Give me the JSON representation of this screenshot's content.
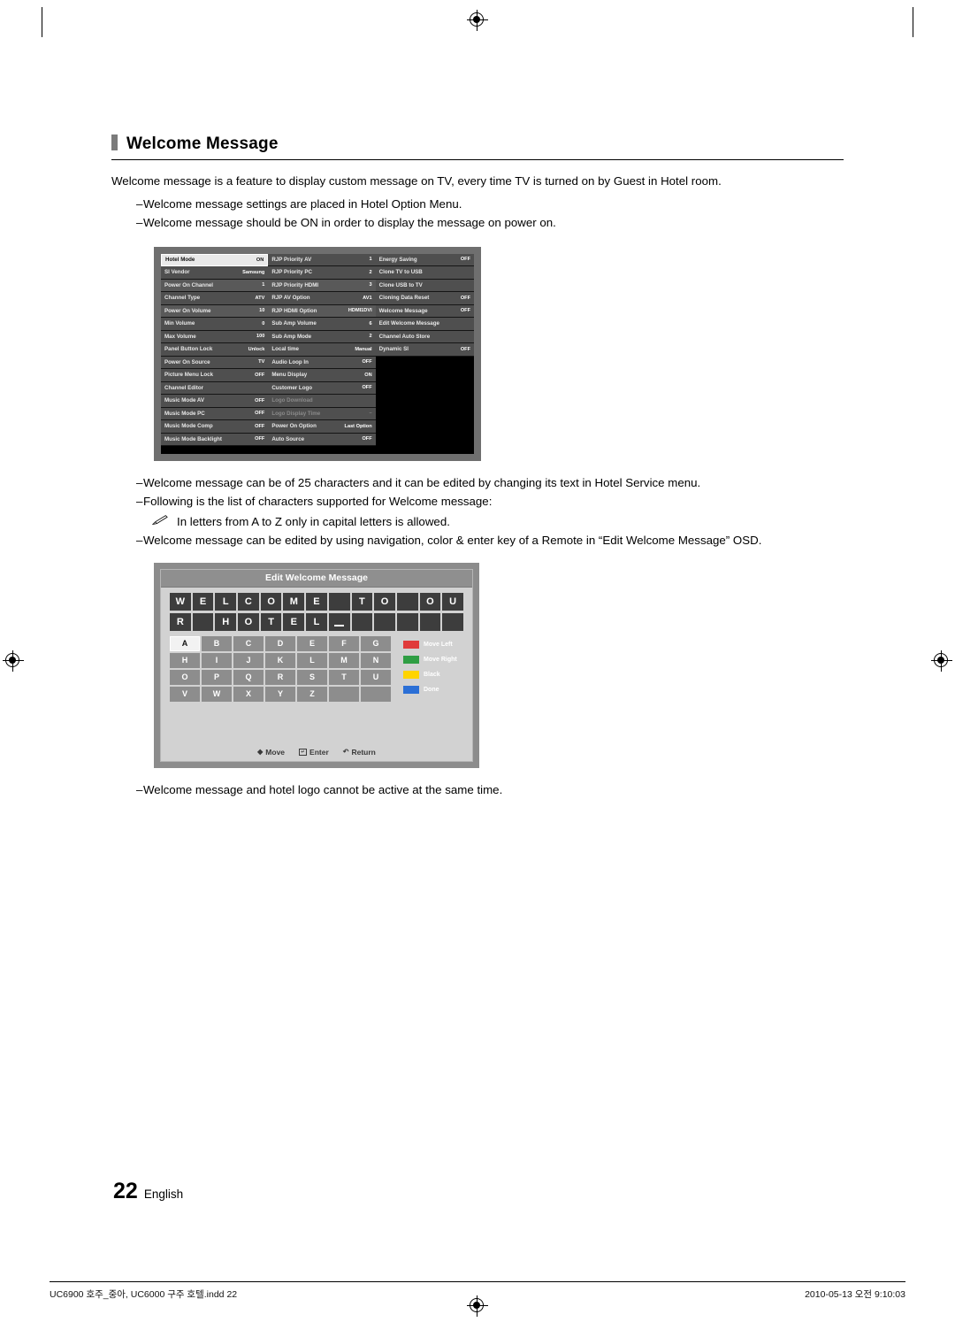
{
  "page": {
    "title": "Welcome Message",
    "intro": "Welcome message is a feature to display custom message on TV, every time TV is turned on by Guest in Hotel room.",
    "bullets_top": [
      "Welcome message settings are placed in Hotel Option Menu.",
      "Welcome message should be ON in order to display the message on power on."
    ],
    "bullets_mid": [
      "Welcome message can be of 25 characters and it can be edited by changing its text in Hotel Service menu.",
      "Following is the list of characters supported for Welcome message:"
    ],
    "note": "In letters from A to Z only in capital letters is allowed.",
    "bullet_osd": "Welcome message can be edited by using navigation, color & enter key of a Remote in “Edit Welcome Message” OSD.",
    "bullet_bottom": "Welcome message and hotel logo cannot be active at the same time.",
    "page_number": "22",
    "language": "English",
    "dash": "–"
  },
  "hotel_menu": {
    "column1": [
      {
        "label": "Hotel Mode",
        "value": "ON",
        "state": "selected"
      },
      {
        "label": "SI Vendor",
        "value": "Samsung",
        "state": "normal"
      },
      {
        "label": "Power On Channel",
        "value": "1",
        "state": "normal"
      },
      {
        "label": "Channel Type",
        "value": "ATV",
        "state": "normal"
      },
      {
        "label": "Power On Volume",
        "value": "10",
        "state": "normal"
      },
      {
        "label": "Min Volume",
        "value": "0",
        "state": "normal"
      },
      {
        "label": "Max Volume",
        "value": "100",
        "state": "normal"
      },
      {
        "label": "Panel Button Lock",
        "value": "Unlock",
        "state": "normal"
      },
      {
        "label": "Power On Source",
        "value": "TV",
        "state": "normal"
      },
      {
        "label": "Picture Menu Lock",
        "value": "OFF",
        "state": "normal"
      },
      {
        "label": "Channel Editor",
        "value": "",
        "state": "normal"
      },
      {
        "label": "Music Mode AV",
        "value": "OFF",
        "state": "normal"
      },
      {
        "label": "Music Mode PC",
        "value": "OFF",
        "state": "normal"
      },
      {
        "label": "Music Mode Comp",
        "value": "OFF",
        "state": "normal"
      },
      {
        "label": "Music Mode Backlight",
        "value": "OFF",
        "state": "normal"
      }
    ],
    "column2": [
      {
        "label": "RJP Priority AV",
        "value": "1",
        "state": "normal"
      },
      {
        "label": "RJP Priority PC",
        "value": "2",
        "state": "normal"
      },
      {
        "label": "RJP Priority HDMI",
        "value": "3",
        "state": "normal"
      },
      {
        "label": "RJP AV Option",
        "value": "AV1",
        "state": "normal"
      },
      {
        "label": "RJP HDMI Option",
        "value": "HDMI1DVI",
        "state": "normal"
      },
      {
        "label": "Sub Amp Volume",
        "value": "6",
        "state": "normal"
      },
      {
        "label": "Sub Amp Mode",
        "value": "2",
        "state": "normal"
      },
      {
        "label": "Local time",
        "value": "Manual",
        "state": "normal"
      },
      {
        "label": "Audio Loop In",
        "value": "OFF",
        "state": "normal"
      },
      {
        "label": "Menu Display",
        "value": "ON",
        "state": "normal"
      },
      {
        "label": "Customer Logo",
        "value": "OFF",
        "state": "normal"
      },
      {
        "label": "Logo Download",
        "value": "",
        "state": "dim"
      },
      {
        "label": "Logo Display Time",
        "value": "–",
        "state": "dim"
      },
      {
        "label": "Power On Option",
        "value": "Last Option",
        "state": "normal"
      },
      {
        "label": "Auto Source",
        "value": "OFF",
        "state": "normal"
      }
    ],
    "column3": [
      {
        "label": "Energy Saving",
        "value": "OFF",
        "state": "normal"
      },
      {
        "label": "Clone TV to USB",
        "value": "",
        "state": "normal"
      },
      {
        "label": "Clone USB to TV",
        "value": "",
        "state": "normal"
      },
      {
        "label": "Cloning Data Reset",
        "value": "OFF",
        "state": "normal"
      },
      {
        "label": "Welcome Message",
        "value": "OFF",
        "state": "normal"
      },
      {
        "label": "Edit Welcome Message",
        "value": "",
        "state": "normal"
      },
      {
        "label": "Channel Auto Store",
        "value": "",
        "state": "normal"
      },
      {
        "label": "Dynamic SI",
        "value": "OFF",
        "state": "normal"
      }
    ]
  },
  "edit_welcome": {
    "title": "Edit Welcome Message",
    "message_row1": [
      "W",
      "E",
      "L",
      "C",
      "O",
      "M",
      "E",
      "",
      "T",
      "O",
      "",
      "O",
      "U"
    ],
    "message_row2": [
      "R",
      "",
      "H",
      "O",
      "T",
      "E",
      "L",
      "_",
      "",
      "",
      "",
      "",
      ""
    ],
    "cursor_index": 7,
    "keyboard_rows": [
      [
        "A",
        "B",
        "C",
        "D",
        "E",
        "F",
        "G"
      ],
      [
        "H",
        "I",
        "J",
        "K",
        "L",
        "M",
        "N"
      ],
      [
        "O",
        "P",
        "Q",
        "R",
        "S",
        "T",
        "U"
      ],
      [
        "V",
        "W",
        "X",
        "Y",
        "Z",
        "",
        ""
      ]
    ],
    "selected_key": "A",
    "legend": [
      {
        "label": "Move Left",
        "color": "#e03a3a"
      },
      {
        "label": "Move Right",
        "color": "#2f9e44"
      },
      {
        "label": "Black",
        "color": "#ffd400"
      },
      {
        "label": "Done",
        "color": "#2b6fd6"
      }
    ],
    "footer": [
      {
        "icon": "dpad-icon",
        "label": "Move"
      },
      {
        "icon": "enter-icon",
        "label": "Enter"
      },
      {
        "icon": "return-icon",
        "label": "Return"
      }
    ]
  },
  "print_footer": {
    "left": "UC6900 호주_중아, UC6000 구주 호텔.indd   22",
    "right": "2010-05-13   오전 9:10:03"
  }
}
